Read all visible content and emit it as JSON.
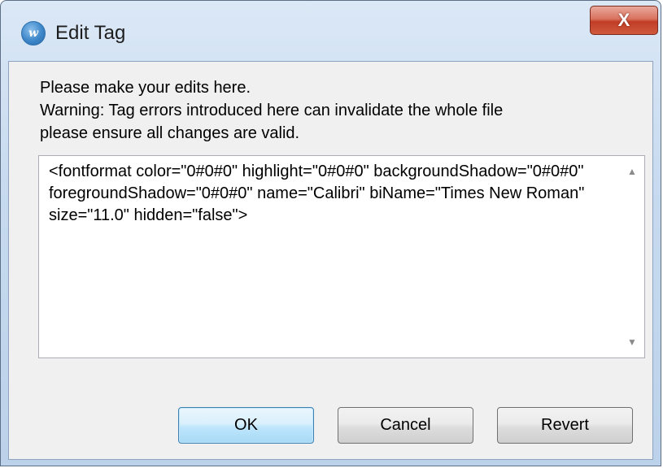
{
  "window": {
    "title": "Edit Tag",
    "icon": "app-logo-icon",
    "icon_glyph": "w",
    "close_glyph": "X",
    "colors": {
      "frame": "#c7daef",
      "close_button": "#c13d26",
      "default_button_border": "#3c7fb1"
    }
  },
  "message": {
    "line1": "Please make your edits here.",
    "line2": "Warning: Tag errors introduced here can invalidate the whole file",
    "line3": "please ensure all changes are valid."
  },
  "editor": {
    "value": "<fontformat color=\"0#0#0\" highlight=\"0#0#0\" backgroundShadow=\"0#0#0\" foregroundShadow=\"0#0#0\" name=\"Calibri\" biName=\"Times New Roman\" size=\"11.0\" hidden=\"false\">",
    "scroll_up_icon": "scroll-up-arrow",
    "scroll_down_icon": "scroll-down-arrow"
  },
  "buttons": {
    "ok_label": "OK",
    "cancel_label": "Cancel",
    "revert_label": "Revert"
  }
}
